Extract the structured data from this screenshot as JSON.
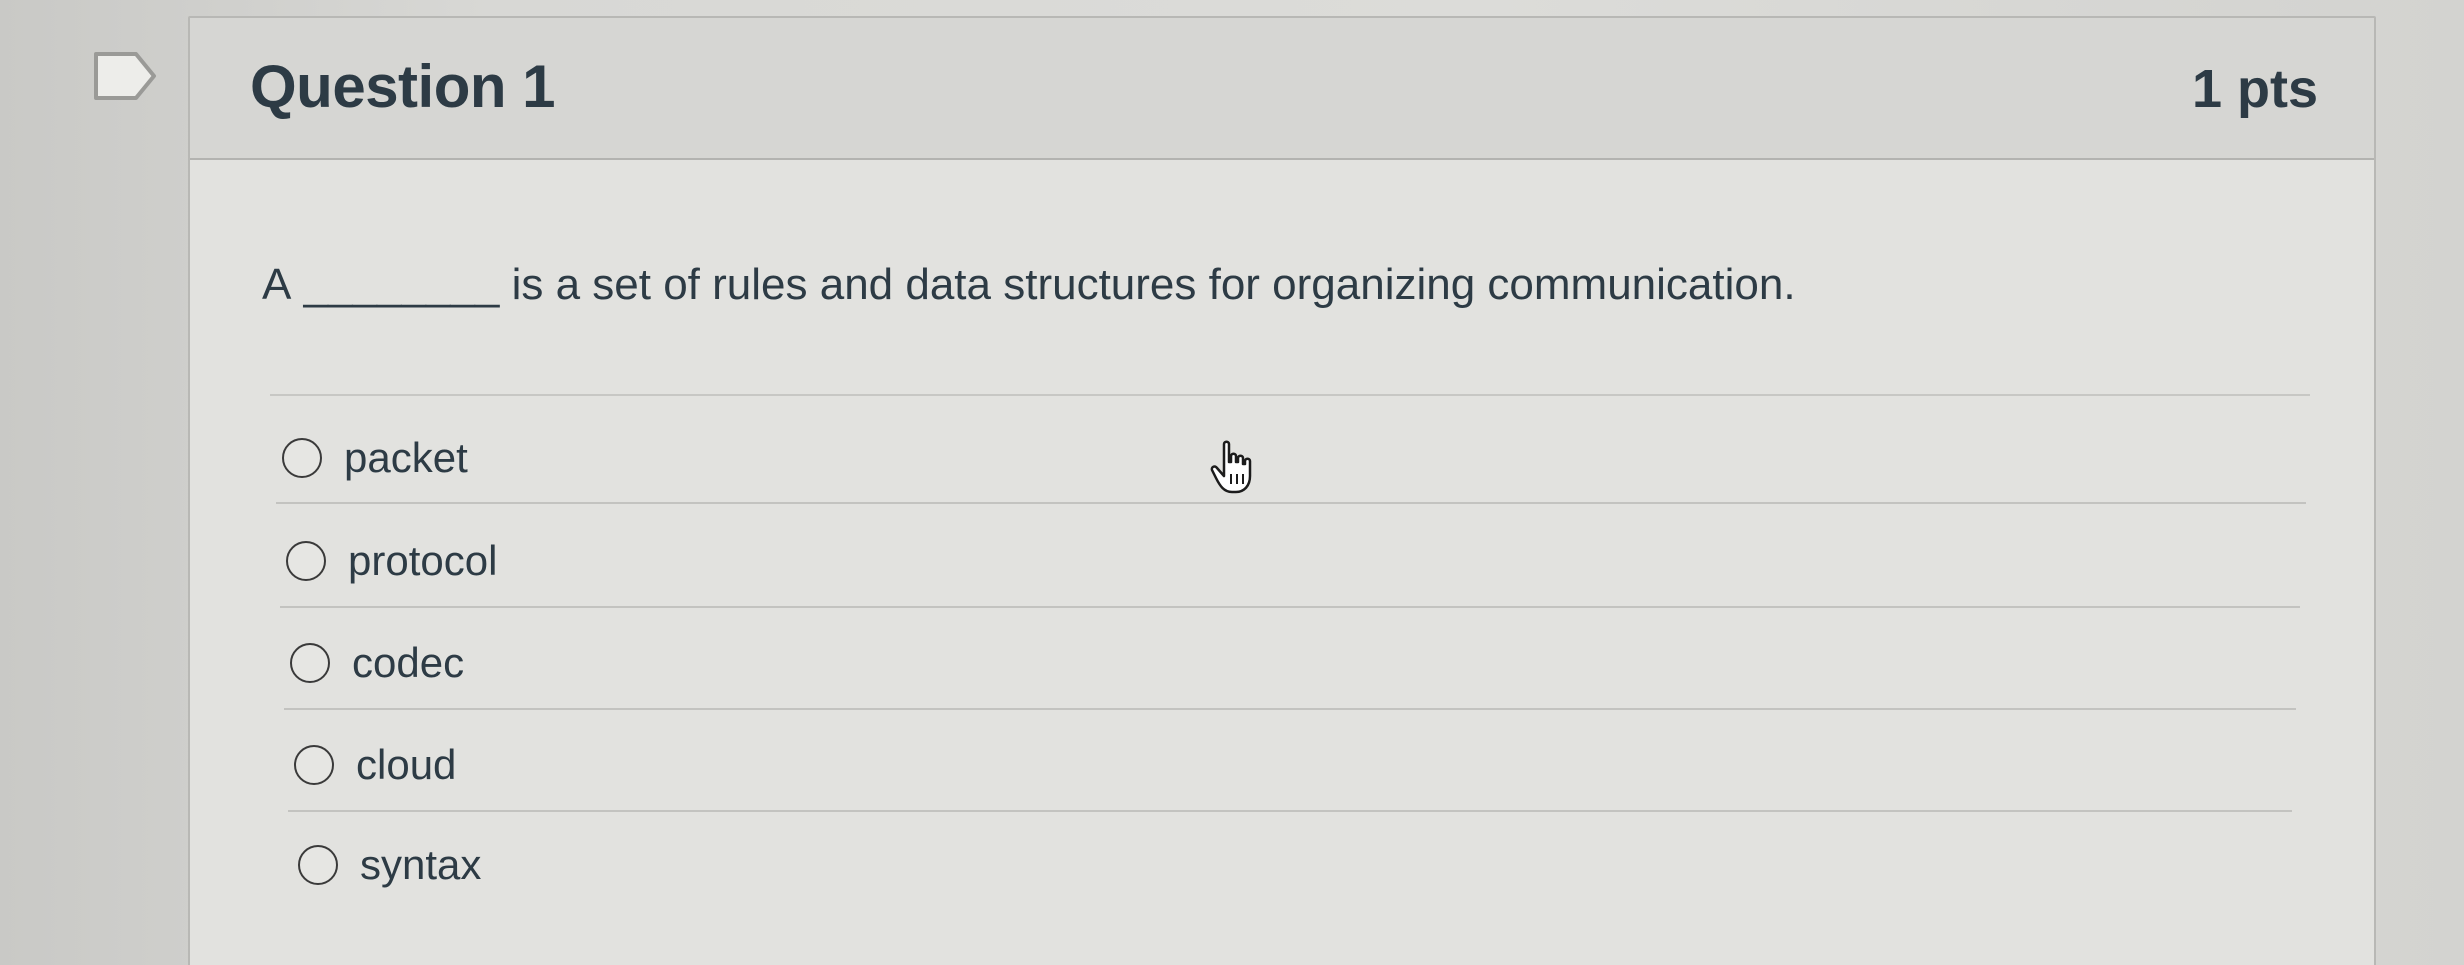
{
  "question": {
    "title": "Question 1",
    "points": "1 pts",
    "text_prefix": "A",
    "blank": "________",
    "text_suffix": "is a set of rules and data structures for organizing communication."
  },
  "answers": [
    {
      "label": "packet",
      "selected": false
    },
    {
      "label": "protocol",
      "selected": false
    },
    {
      "label": "codec",
      "selected": false
    },
    {
      "label": "cloud",
      "selected": false
    },
    {
      "label": "syntax",
      "selected": false
    }
  ],
  "icons": {
    "flag": "flag-icon",
    "cursor": "hand-pointer-icon"
  },
  "colors": {
    "text": "#2d3b45",
    "header_bg": "#d6d6d3",
    "border": "#b8b8b5"
  }
}
